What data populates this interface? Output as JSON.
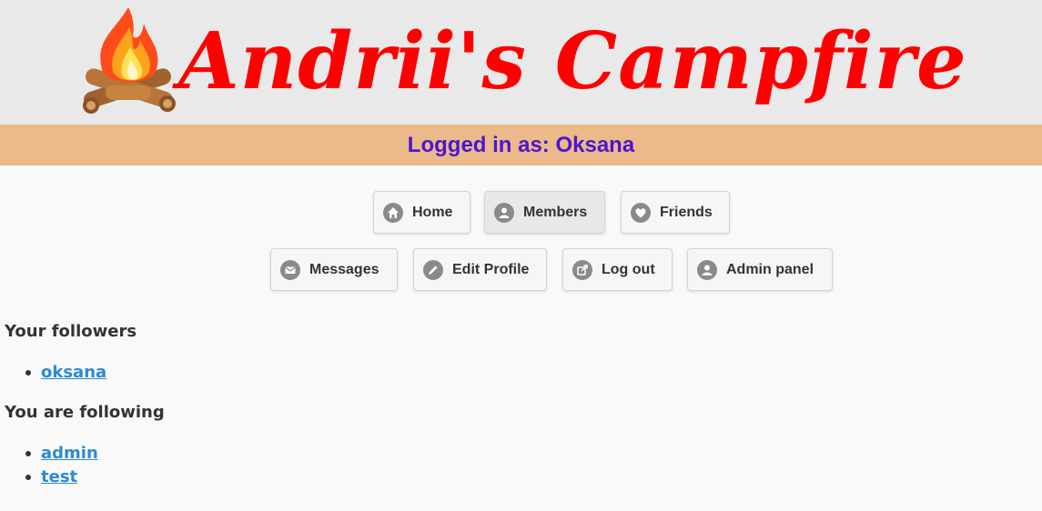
{
  "header": {
    "title": "Andrii's Campfire",
    "logo_icon": "campfire-icon"
  },
  "status": {
    "logged_in_text": "Logged in as: Oksana"
  },
  "nav": {
    "home": "Home",
    "members": "Members",
    "friends": "Friends",
    "messages": "Messages",
    "edit_profile": "Edit Profile",
    "log_out": "Log out",
    "admin_panel": "Admin panel"
  },
  "followers": {
    "heading": "Your followers",
    "items": [
      "oksana"
    ]
  },
  "following": {
    "heading": "You are following",
    "items": [
      "admin",
      "test"
    ]
  },
  "colors": {
    "title": "#ff0000",
    "status_bar": "#ebb98a",
    "status_text": "#4a17d0",
    "link": "#2f8ad0"
  }
}
